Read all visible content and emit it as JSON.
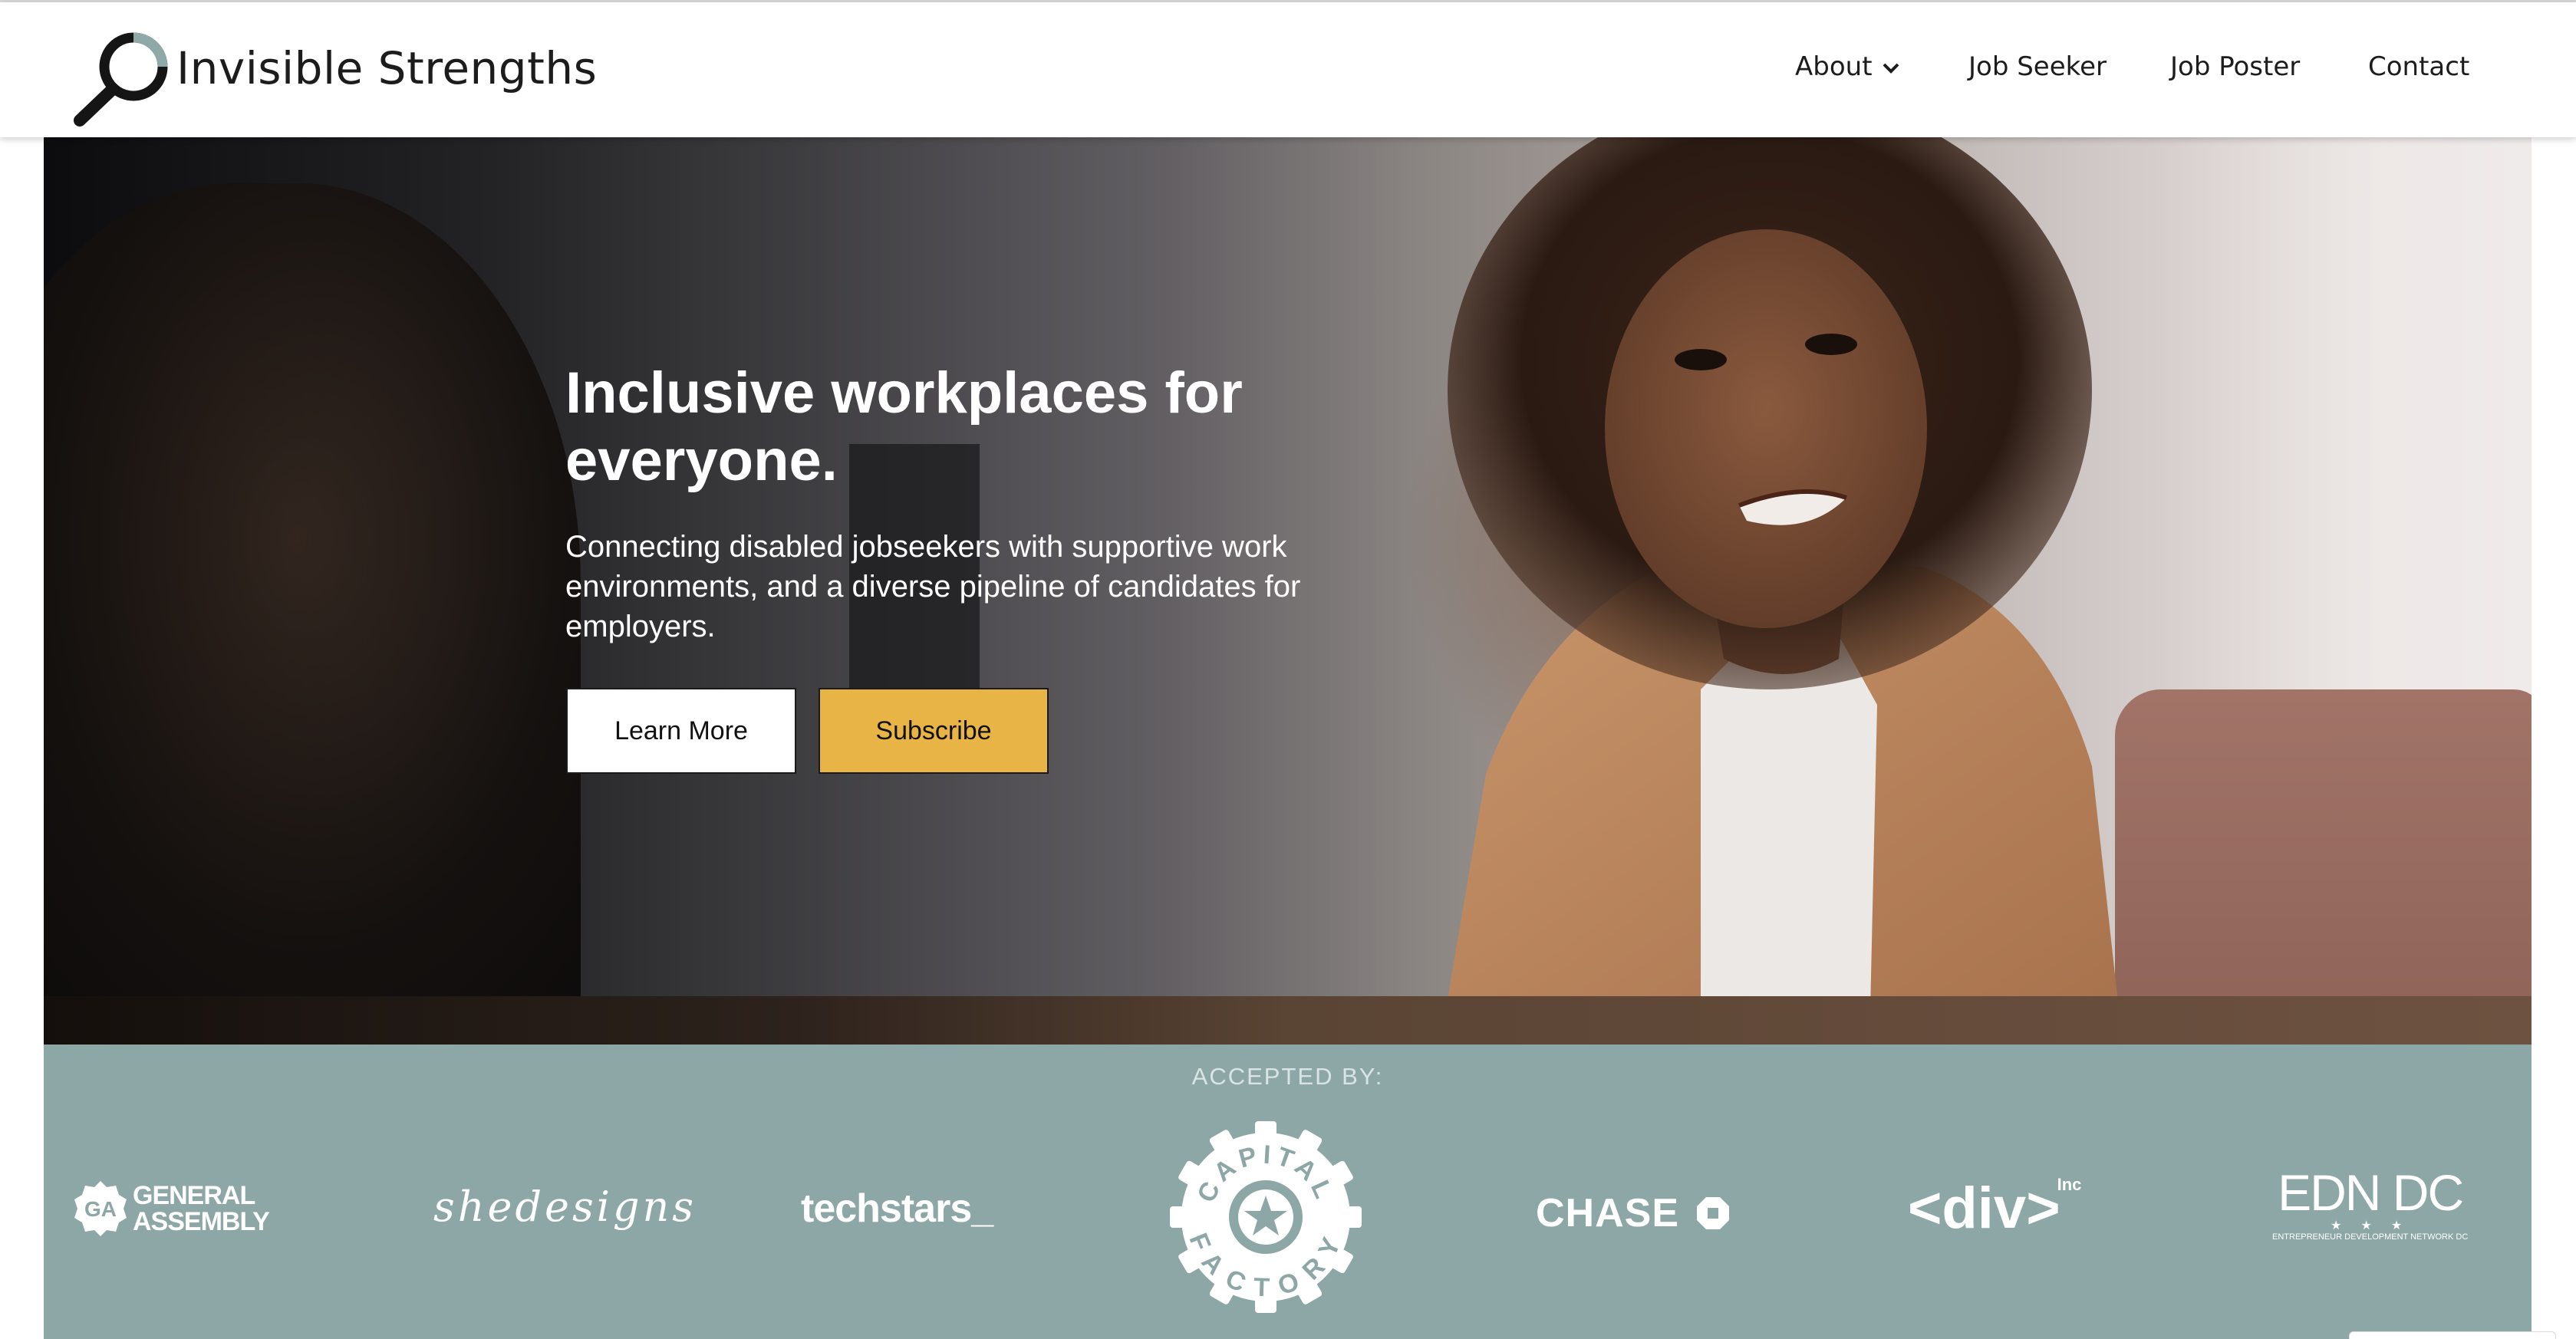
{
  "brand": {
    "name": "Invisible Strengths",
    "icon": "magnifying-glass-logo-icon"
  },
  "nav": {
    "items": [
      {
        "label": "About",
        "has_dropdown": true,
        "icon": "chevron-down-icon"
      },
      {
        "label": "Job Seeker"
      },
      {
        "label": "Job Poster"
      },
      {
        "label": "Contact"
      }
    ]
  },
  "hero": {
    "title": "Inclusive workplaces for everyone.",
    "subtitle": "Connecting disabled jobseekers with supportive work environments, and a diverse pipeline of candidates for employers.",
    "buttons": {
      "learn_more": "Learn More",
      "subscribe": "Subscribe"
    },
    "image_description_icon": "hero-photo"
  },
  "accepted": {
    "label": "ACCEPTED BY:",
    "partners": [
      {
        "name": "GENERAL ASSEMBLY",
        "line1": "GENERAL",
        "line2": "ASSEMBLY",
        "badge": "GA"
      },
      {
        "name": "shedesigns"
      },
      {
        "name": "techstars_"
      },
      {
        "name": "CAPITAL FACTORY",
        "top": "CAPITAL",
        "bottom": "FACTORY"
      },
      {
        "name": "CHASE"
      },
      {
        "name": "<div>",
        "sup": "Inc"
      },
      {
        "name": "EDN DC",
        "stars": "★ ★ ★",
        "sub": "ENTREPRENEUR DEVELOPMENT NETWORK DC"
      }
    ]
  },
  "colors": {
    "accent_yellow": "#e8b445",
    "band_teal": "#8da7a7",
    "text_dark": "#1c1c1c",
    "white": "#ffffff"
  }
}
